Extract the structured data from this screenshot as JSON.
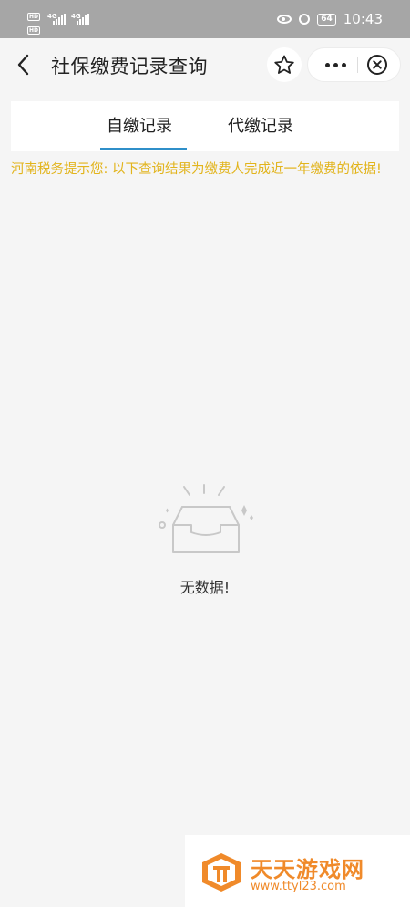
{
  "status_bar": {
    "network_1": "4G",
    "network_2": "4G",
    "hd_1": "HD",
    "hd_2": "HD",
    "battery": "64",
    "time": "10:43"
  },
  "navbar": {
    "title": "社保缴费记录查询"
  },
  "tabs": [
    {
      "label": "自缴记录",
      "active": true
    },
    {
      "label": "代缴记录",
      "active": false
    }
  ],
  "notice": "河南税务提示您: 以下查询结果为缴费人完成近一年缴费的依据!",
  "empty_state": {
    "text": "无数据!"
  },
  "watermark": {
    "title": "天天游戏网",
    "url": "www.ttyl23.com"
  },
  "colors": {
    "accent_tab": "#2f8fc9",
    "notice": "#e2b41c",
    "watermark": "#f08a2a"
  }
}
